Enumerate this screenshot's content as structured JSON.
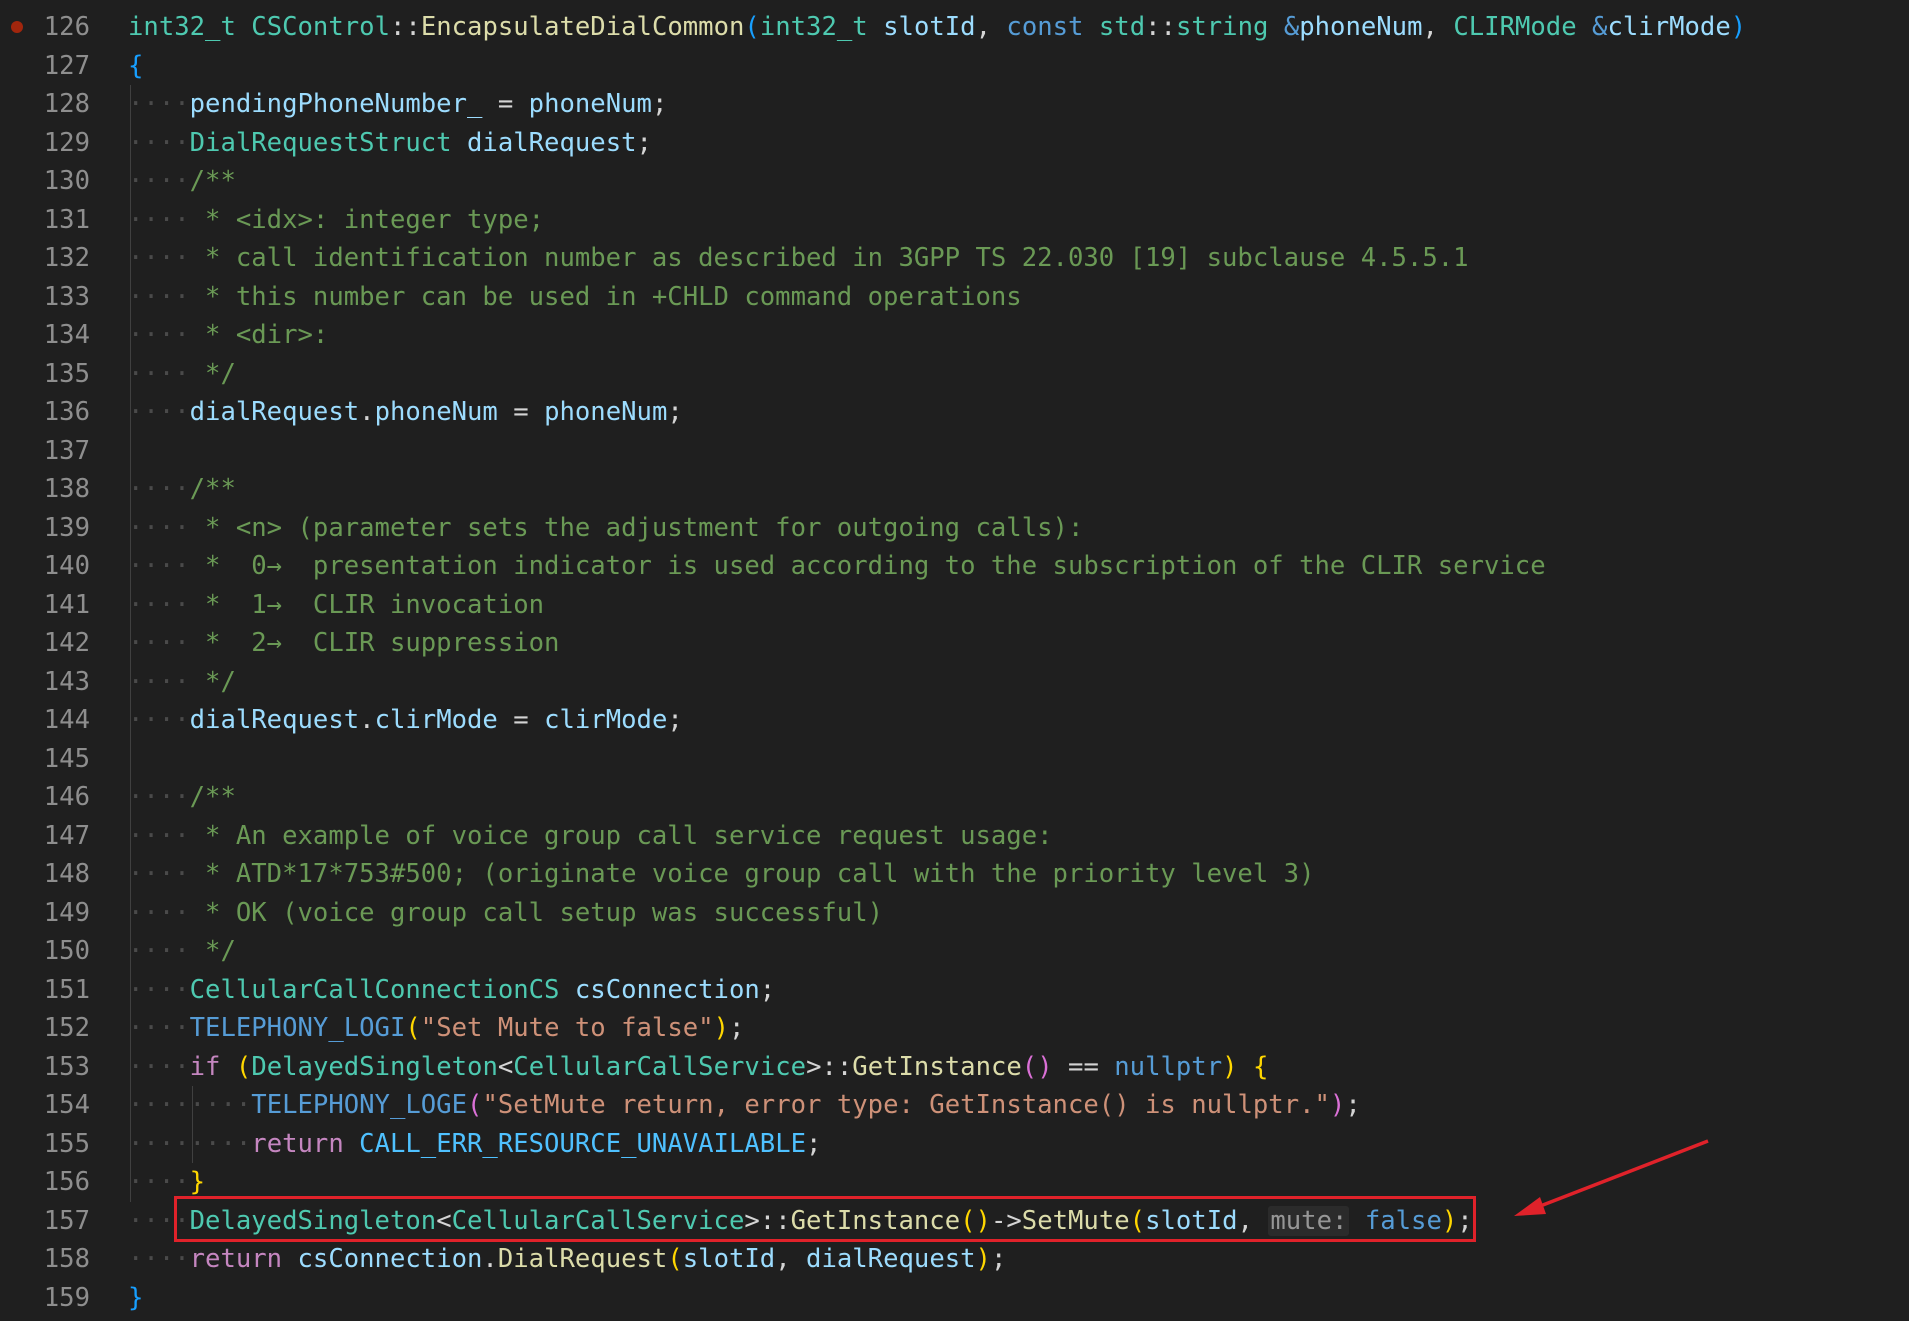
{
  "editor": {
    "language": "C++",
    "breakpoint_line": "126",
    "lines": [
      {
        "n": "126",
        "t": [
          [
            "ty",
            "int32_t"
          ],
          [
            "op",
            " "
          ],
          [
            "ty",
            "CSControl"
          ],
          [
            "op",
            "::"
          ],
          [
            "fn",
            "EncapsulateDialCommon"
          ],
          [
            "p3",
            "("
          ],
          [
            "ty",
            "int32_t"
          ],
          [
            "op",
            " "
          ],
          [
            "va",
            "slotId"
          ],
          [
            "op",
            ", "
          ],
          [
            "kw",
            "const"
          ],
          [
            "op",
            " "
          ],
          [
            "ty",
            "std"
          ],
          [
            "op",
            "::"
          ],
          [
            "ty",
            "string"
          ],
          [
            "op",
            " "
          ],
          [
            "kw",
            "&"
          ],
          [
            "va",
            "phoneNum"
          ],
          [
            "op",
            ", "
          ],
          [
            "ty",
            "CLIRMode"
          ],
          [
            "op",
            " "
          ],
          [
            "kw",
            "&"
          ],
          [
            "va",
            "clirMode"
          ],
          [
            "p3",
            ")"
          ]
        ]
      },
      {
        "n": "127",
        "t": [
          [
            "p3",
            "{"
          ]
        ]
      },
      {
        "n": "128",
        "t": [
          [
            "ws",
            "····"
          ],
          [
            "va",
            "pendingPhoneNumber_"
          ],
          [
            "op",
            " = "
          ],
          [
            "va",
            "phoneNum"
          ],
          [
            "op",
            ";"
          ]
        ]
      },
      {
        "n": "129",
        "t": [
          [
            "ws",
            "····"
          ],
          [
            "ty",
            "DialRequestStruct"
          ],
          [
            "op",
            " "
          ],
          [
            "va",
            "dialRequest"
          ],
          [
            "op",
            ";"
          ]
        ]
      },
      {
        "n": "130",
        "t": [
          [
            "ws",
            "····"
          ],
          [
            "cm",
            "/**"
          ]
        ]
      },
      {
        "n": "131",
        "t": [
          [
            "ws",
            "····"
          ],
          [
            "cm",
            " * <idx>: integer type;"
          ]
        ]
      },
      {
        "n": "132",
        "t": [
          [
            "ws",
            "····"
          ],
          [
            "cm",
            " * call identification number as described in 3GPP TS 22.030 [19] subclause 4.5.5.1"
          ]
        ]
      },
      {
        "n": "133",
        "t": [
          [
            "ws",
            "····"
          ],
          [
            "cm",
            " * this number can be used in +CHLD command operations"
          ]
        ]
      },
      {
        "n": "134",
        "t": [
          [
            "ws",
            "····"
          ],
          [
            "cm",
            " * <dir>:"
          ]
        ]
      },
      {
        "n": "135",
        "t": [
          [
            "ws",
            "····"
          ],
          [
            "cm",
            " */"
          ]
        ]
      },
      {
        "n": "136",
        "t": [
          [
            "ws",
            "····"
          ],
          [
            "va",
            "dialRequest"
          ],
          [
            "op",
            "."
          ],
          [
            "va",
            "phoneNum"
          ],
          [
            "op",
            " = "
          ],
          [
            "va",
            "phoneNum"
          ],
          [
            "op",
            ";"
          ]
        ]
      },
      {
        "n": "137",
        "t": []
      },
      {
        "n": "138",
        "t": [
          [
            "ws",
            "····"
          ],
          [
            "cm",
            "/**"
          ]
        ]
      },
      {
        "n": "139",
        "t": [
          [
            "ws",
            "····"
          ],
          [
            "cm",
            " * <n> (parameter sets the adjustment for outgoing calls):"
          ]
        ]
      },
      {
        "n": "140",
        "t": [
          [
            "ws",
            "····"
          ],
          [
            "cm",
            " *  0→  presentation indicator is used according to the subscription of the CLIR service"
          ]
        ]
      },
      {
        "n": "141",
        "t": [
          [
            "ws",
            "····"
          ],
          [
            "cm",
            " *  1→  CLIR invocation"
          ]
        ]
      },
      {
        "n": "142",
        "t": [
          [
            "ws",
            "····"
          ],
          [
            "cm",
            " *  2→  CLIR suppression"
          ]
        ]
      },
      {
        "n": "143",
        "t": [
          [
            "ws",
            "····"
          ],
          [
            "cm",
            " */"
          ]
        ]
      },
      {
        "n": "144",
        "t": [
          [
            "ws",
            "····"
          ],
          [
            "va",
            "dialRequest"
          ],
          [
            "op",
            "."
          ],
          [
            "va",
            "clirMode"
          ],
          [
            "op",
            " = "
          ],
          [
            "va",
            "clirMode"
          ],
          [
            "op",
            ";"
          ]
        ]
      },
      {
        "n": "145",
        "t": []
      },
      {
        "n": "146",
        "t": [
          [
            "ws",
            "····"
          ],
          [
            "cm",
            "/**"
          ]
        ]
      },
      {
        "n": "147",
        "t": [
          [
            "ws",
            "····"
          ],
          [
            "cm",
            " * An example of voice group call service request usage:"
          ]
        ]
      },
      {
        "n": "148",
        "t": [
          [
            "ws",
            "····"
          ],
          [
            "cm",
            " * ATD*17*753#500; (originate voice group call with the priority level 3)"
          ]
        ]
      },
      {
        "n": "149",
        "t": [
          [
            "ws",
            "····"
          ],
          [
            "cm",
            " * OK (voice group call setup was successful)"
          ]
        ]
      },
      {
        "n": "150",
        "t": [
          [
            "ws",
            "····"
          ],
          [
            "cm",
            " */"
          ]
        ]
      },
      {
        "n": "151",
        "t": [
          [
            "ws",
            "····"
          ],
          [
            "ty",
            "CellularCallConnectionCS"
          ],
          [
            "op",
            " "
          ],
          [
            "va",
            "csConnection"
          ],
          [
            "op",
            ";"
          ]
        ]
      },
      {
        "n": "152",
        "t": [
          [
            "ws",
            "····"
          ],
          [
            "ma",
            "TELEPHONY_LOGI"
          ],
          [
            "p1",
            "("
          ],
          [
            "st",
            "\"Set Mute to false\""
          ],
          [
            "p1",
            ")"
          ],
          [
            "op",
            ";"
          ]
        ]
      },
      {
        "n": "153",
        "t": [
          [
            "ws",
            "····"
          ],
          [
            "ct",
            "if"
          ],
          [
            "op",
            " "
          ],
          [
            "p1",
            "("
          ],
          [
            "ty",
            "DelayedSingleton"
          ],
          [
            "op",
            "<"
          ],
          [
            "ty",
            "CellularCallService"
          ],
          [
            "op",
            ">::"
          ],
          [
            "fn",
            "GetInstance"
          ],
          [
            "p2",
            "()"
          ],
          [
            "op",
            " == "
          ],
          [
            "kw",
            "nullptr"
          ],
          [
            "p1",
            ")"
          ],
          [
            "op",
            " "
          ],
          [
            "p1",
            "{"
          ]
        ]
      },
      {
        "n": "154",
        "t": [
          [
            "ws",
            "········"
          ],
          [
            "ma",
            "TELEPHONY_LOGE"
          ],
          [
            "p2",
            "("
          ],
          [
            "st",
            "\"SetMute return, error type: GetInstance() is nullptr.\""
          ],
          [
            "p2",
            ")"
          ],
          [
            "op",
            ";"
          ]
        ]
      },
      {
        "n": "155",
        "t": [
          [
            "ws",
            "········"
          ],
          [
            "ct",
            "return"
          ],
          [
            "op",
            " "
          ],
          [
            "cn",
            "CALL_ERR_RESOURCE_UNAVAILABLE"
          ],
          [
            "op",
            ";"
          ]
        ]
      },
      {
        "n": "156",
        "t": [
          [
            "ws",
            "····"
          ],
          [
            "p1",
            "}"
          ]
        ]
      },
      {
        "n": "157",
        "t": [
          [
            "ws",
            "····"
          ],
          [
            "ty",
            "DelayedSingleton"
          ],
          [
            "op",
            "<"
          ],
          [
            "ty",
            "CellularCallService"
          ],
          [
            "op",
            ">::"
          ],
          [
            "fn",
            "GetInstance"
          ],
          [
            "p1",
            "()"
          ],
          [
            "op",
            "->"
          ],
          [
            "fn",
            "SetMute"
          ],
          [
            "p1",
            "("
          ],
          [
            "va",
            "slotId"
          ],
          [
            "op",
            ", "
          ],
          [
            "hint",
            "mute:"
          ],
          [
            "op",
            " "
          ],
          [
            "kw",
            "false"
          ],
          [
            "p1",
            ")"
          ],
          [
            "op",
            ";"
          ]
        ]
      },
      {
        "n": "158",
        "t": [
          [
            "ws",
            "····"
          ],
          [
            "ct",
            "return"
          ],
          [
            "op",
            " "
          ],
          [
            "va",
            "csConnection"
          ],
          [
            "op",
            "."
          ],
          [
            "fn",
            "DialRequest"
          ],
          [
            "p1",
            "("
          ],
          [
            "va",
            "slotId"
          ],
          [
            "op",
            ", "
          ],
          [
            "va",
            "dialRequest"
          ],
          [
            "p1",
            ")"
          ],
          [
            "op",
            ";"
          ]
        ]
      },
      {
        "n": "159",
        "t": [
          [
            "p3",
            "}"
          ]
        ]
      }
    ]
  },
  "annotation": {
    "highlighted_line": "157",
    "box_color": "#e0222a",
    "arrow_color": "#e0222a"
  }
}
